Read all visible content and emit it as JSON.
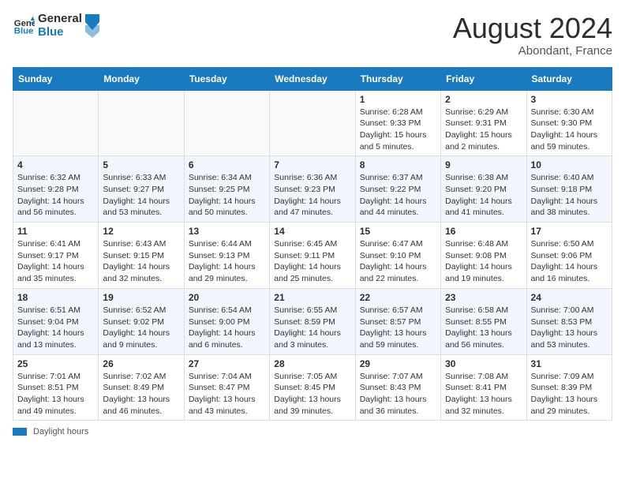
{
  "logo": {
    "line1": "General",
    "line2": "Blue"
  },
  "title": "August 2024",
  "subtitle": "Abondant, France",
  "days_header": [
    "Sunday",
    "Monday",
    "Tuesday",
    "Wednesday",
    "Thursday",
    "Friday",
    "Saturday"
  ],
  "weeks": [
    [
      {
        "day": "",
        "info": ""
      },
      {
        "day": "",
        "info": ""
      },
      {
        "day": "",
        "info": ""
      },
      {
        "day": "",
        "info": ""
      },
      {
        "day": "1",
        "info": "Sunrise: 6:28 AM\nSunset: 9:33 PM\nDaylight: 15 hours and 5 minutes."
      },
      {
        "day": "2",
        "info": "Sunrise: 6:29 AM\nSunset: 9:31 PM\nDaylight: 15 hours and 2 minutes."
      },
      {
        "day": "3",
        "info": "Sunrise: 6:30 AM\nSunset: 9:30 PM\nDaylight: 14 hours and 59 minutes."
      }
    ],
    [
      {
        "day": "4",
        "info": "Sunrise: 6:32 AM\nSunset: 9:28 PM\nDaylight: 14 hours and 56 minutes."
      },
      {
        "day": "5",
        "info": "Sunrise: 6:33 AM\nSunset: 9:27 PM\nDaylight: 14 hours and 53 minutes."
      },
      {
        "day": "6",
        "info": "Sunrise: 6:34 AM\nSunset: 9:25 PM\nDaylight: 14 hours and 50 minutes."
      },
      {
        "day": "7",
        "info": "Sunrise: 6:36 AM\nSunset: 9:23 PM\nDaylight: 14 hours and 47 minutes."
      },
      {
        "day": "8",
        "info": "Sunrise: 6:37 AM\nSunset: 9:22 PM\nDaylight: 14 hours and 44 minutes."
      },
      {
        "day": "9",
        "info": "Sunrise: 6:38 AM\nSunset: 9:20 PM\nDaylight: 14 hours and 41 minutes."
      },
      {
        "day": "10",
        "info": "Sunrise: 6:40 AM\nSunset: 9:18 PM\nDaylight: 14 hours and 38 minutes."
      }
    ],
    [
      {
        "day": "11",
        "info": "Sunrise: 6:41 AM\nSunset: 9:17 PM\nDaylight: 14 hours and 35 minutes."
      },
      {
        "day": "12",
        "info": "Sunrise: 6:43 AM\nSunset: 9:15 PM\nDaylight: 14 hours and 32 minutes."
      },
      {
        "day": "13",
        "info": "Sunrise: 6:44 AM\nSunset: 9:13 PM\nDaylight: 14 hours and 29 minutes."
      },
      {
        "day": "14",
        "info": "Sunrise: 6:45 AM\nSunset: 9:11 PM\nDaylight: 14 hours and 25 minutes."
      },
      {
        "day": "15",
        "info": "Sunrise: 6:47 AM\nSunset: 9:10 PM\nDaylight: 14 hours and 22 minutes."
      },
      {
        "day": "16",
        "info": "Sunrise: 6:48 AM\nSunset: 9:08 PM\nDaylight: 14 hours and 19 minutes."
      },
      {
        "day": "17",
        "info": "Sunrise: 6:50 AM\nSunset: 9:06 PM\nDaylight: 14 hours and 16 minutes."
      }
    ],
    [
      {
        "day": "18",
        "info": "Sunrise: 6:51 AM\nSunset: 9:04 PM\nDaylight: 14 hours and 13 minutes."
      },
      {
        "day": "19",
        "info": "Sunrise: 6:52 AM\nSunset: 9:02 PM\nDaylight: 14 hours and 9 minutes."
      },
      {
        "day": "20",
        "info": "Sunrise: 6:54 AM\nSunset: 9:00 PM\nDaylight: 14 hours and 6 minutes."
      },
      {
        "day": "21",
        "info": "Sunrise: 6:55 AM\nSunset: 8:59 PM\nDaylight: 14 hours and 3 minutes."
      },
      {
        "day": "22",
        "info": "Sunrise: 6:57 AM\nSunset: 8:57 PM\nDaylight: 13 hours and 59 minutes."
      },
      {
        "day": "23",
        "info": "Sunrise: 6:58 AM\nSunset: 8:55 PM\nDaylight: 13 hours and 56 minutes."
      },
      {
        "day": "24",
        "info": "Sunrise: 7:00 AM\nSunset: 8:53 PM\nDaylight: 13 hours and 53 minutes."
      }
    ],
    [
      {
        "day": "25",
        "info": "Sunrise: 7:01 AM\nSunset: 8:51 PM\nDaylight: 13 hours and 49 minutes."
      },
      {
        "day": "26",
        "info": "Sunrise: 7:02 AM\nSunset: 8:49 PM\nDaylight: 13 hours and 46 minutes."
      },
      {
        "day": "27",
        "info": "Sunrise: 7:04 AM\nSunset: 8:47 PM\nDaylight: 13 hours and 43 minutes."
      },
      {
        "day": "28",
        "info": "Sunrise: 7:05 AM\nSunset: 8:45 PM\nDaylight: 13 hours and 39 minutes."
      },
      {
        "day": "29",
        "info": "Sunrise: 7:07 AM\nSunset: 8:43 PM\nDaylight: 13 hours and 36 minutes."
      },
      {
        "day": "30",
        "info": "Sunrise: 7:08 AM\nSunset: 8:41 PM\nDaylight: 13 hours and 32 minutes."
      },
      {
        "day": "31",
        "info": "Sunrise: 7:09 AM\nSunset: 8:39 PM\nDaylight: 13 hours and 29 minutes."
      }
    ]
  ],
  "footer": {
    "bar_label": "Daylight hours"
  }
}
